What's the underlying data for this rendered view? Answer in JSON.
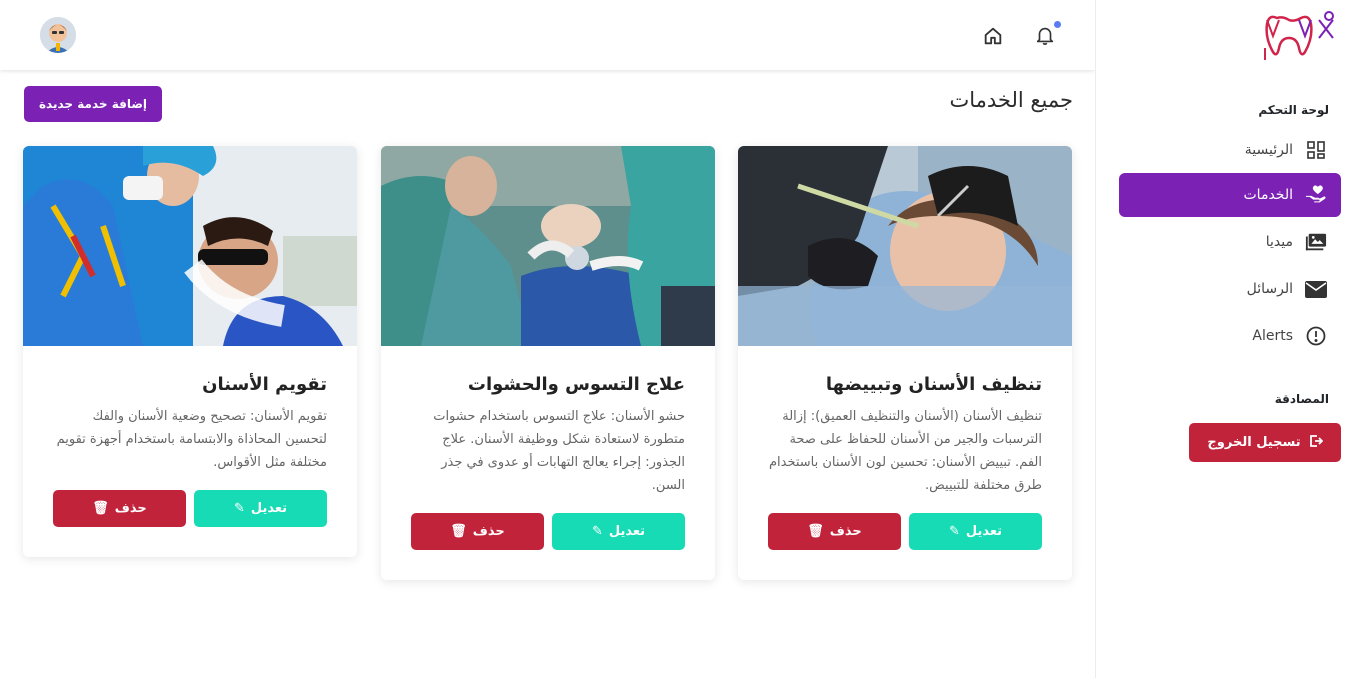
{
  "brand": {
    "accent": "#7b22b5",
    "danger": "#c1233a",
    "success": "#17dbb5"
  },
  "sidebar": {
    "section_dashboard": "لوحة التحكم",
    "items": [
      {
        "label": "الرئيسية",
        "icon": "grid-icon"
      },
      {
        "label": "الخدمات",
        "icon": "hand-heart-icon",
        "active": true
      },
      {
        "label": "ميديا",
        "icon": "images-icon"
      },
      {
        "label": "الرسائل",
        "icon": "envelope-icon"
      },
      {
        "label": "Alerts",
        "icon": "alert-circle-icon"
      }
    ],
    "section_auth": "المصادقة",
    "logout_label": "تسجيل الخروج"
  },
  "header": {
    "page_title": "جميع الخدمات",
    "add_button": "إضافة خدمة جديدة"
  },
  "services": [
    {
      "title": "تنظيف الأسنان وتبييضها",
      "description": "تنظيف الأسنان (الأسنان والتنظيف العميق): إزالة الترسبات والجير من الأسنان للحفاظ على صحة الفم. تبييض الأسنان: تحسين لون الأسنان باستخدام طرق مختلفة للتبييض.",
      "edit_label": "تعديل",
      "delete_label": "حذف"
    },
    {
      "title": "علاج التسوس والحشوات",
      "description": "حشو الأسنان: علاج التسوس باستخدام حشوات متطورة لاستعادة شكل ووظيفة الأسنان. علاج الجذور: إجراء يعالج التهابات أو عدوى في جذر السن.",
      "edit_label": "تعديل",
      "delete_label": "حذف"
    },
    {
      "title": "تقويم الأسنان",
      "description": "تقويم الأسنان: تصحيح وضعية الأسنان والفك لتحسين المحاذاة والابتسامة باستخدام أجهزة تقويم مختلفة مثل الأقواس.",
      "edit_label": "تعديل",
      "delete_label": "حذف"
    }
  ]
}
